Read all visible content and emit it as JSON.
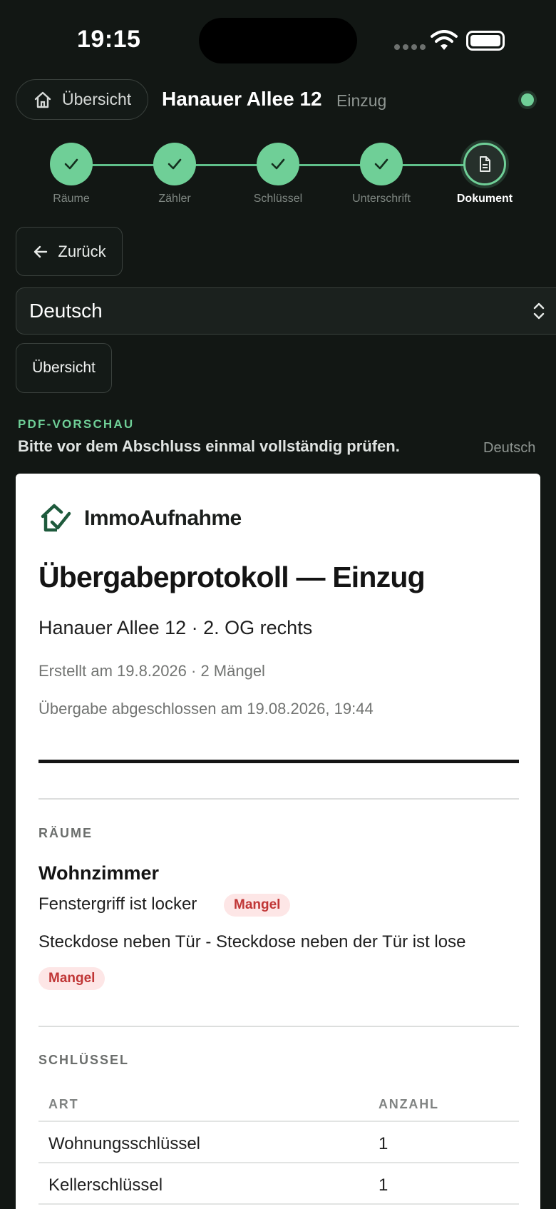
{
  "status_bar": {
    "time": "19:15"
  },
  "header": {
    "home_button_label": "Übersicht",
    "property_title": "Hanauer Allee 12",
    "mode": "Einzug",
    "online_color": "#6fcf97"
  },
  "stepper": {
    "steps": [
      {
        "label": "Räume",
        "state": "done"
      },
      {
        "label": "Zähler",
        "state": "done"
      },
      {
        "label": "Schlüssel",
        "state": "done"
      },
      {
        "label": "Unterschrift",
        "state": "done"
      },
      {
        "label": "Dokument",
        "state": "current"
      }
    ]
  },
  "controls": {
    "back_label": "Zurück",
    "language_selected": "Deutsch",
    "overview_label": "Übersicht"
  },
  "preview": {
    "kicker": "PDF-VORSCHAU",
    "hint": "Bitte vor dem Abschluss einmal vollständig prüfen.",
    "language": "Deutsch"
  },
  "document": {
    "brand": "ImmoAufnahme",
    "title": "Übergabeprotokoll — Einzug",
    "address": "Hanauer Allee 12 · 2. OG rechts",
    "meta": "Erstellt am 19.8.2026 · 2 Mängel",
    "completed": "Übergabe abgeschlossen am 19.08.2026, 19:44",
    "rooms_heading": "RÄUME",
    "room": {
      "name": "Wohnzimmer",
      "items": [
        {
          "text": "Fenstergriff ist locker",
          "badge": "Mangel"
        },
        {
          "text": "Steckdose neben Tür - Steckdose neben der Tür ist lose",
          "badge": "Mangel"
        }
      ]
    },
    "keys_heading": "SCHLÜSSEL",
    "keys_table": {
      "columns": [
        "ART",
        "ANZAHL"
      ],
      "rows": [
        [
          "Wohnungsschlüssel",
          "1"
        ],
        [
          "Kellerschlüssel",
          "1"
        ]
      ]
    },
    "brand_color": "#1e5a3c",
    "defect_color": "#c03636"
  }
}
